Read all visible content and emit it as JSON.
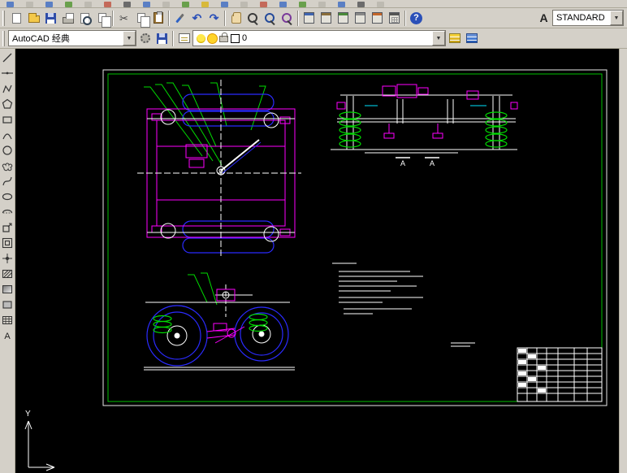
{
  "chrome": {
    "glyphs": {
      "dropdown": "▼",
      "cut": "✂",
      "undo": "↶",
      "redo": "↷",
      "help": "?",
      "text_style": "A",
      "mtext": "A"
    },
    "standard_toolbar": {
      "icons": [
        "qnew",
        "open",
        "save",
        "plot",
        "plot-preview",
        "publish",
        "cut",
        "copy",
        "paste",
        "match-properties",
        "undo",
        "redo",
        "pan",
        "zoom-realtime",
        "zoom-window",
        "zoom-previous",
        "properties",
        "designcenter",
        "tool-palettes",
        "sheet-set-manager",
        "markup-set-manager",
        "quickcalc",
        "help"
      ]
    },
    "styles_toolbar": {
      "text_style_value": "STANDARD"
    },
    "workspaces_toolbar": {
      "workspace_value": "AutoCAD 经典"
    },
    "layers_toolbar": {
      "current_layer": "0"
    }
  },
  "draw_toolbar": {
    "icons": [
      "line",
      "construction-line",
      "polyline",
      "polygon",
      "rectangle",
      "arc",
      "circle",
      "revision-cloud",
      "spline",
      "ellipse",
      "ellipse-arc",
      "insert-block",
      "make-block",
      "point",
      "hatch",
      "gradient",
      "region",
      "table",
      "multiline-text"
    ]
  },
  "drawing": {
    "section_label_left": "A",
    "section_label_right": "A",
    "ucs_axis_label": "Y"
  }
}
